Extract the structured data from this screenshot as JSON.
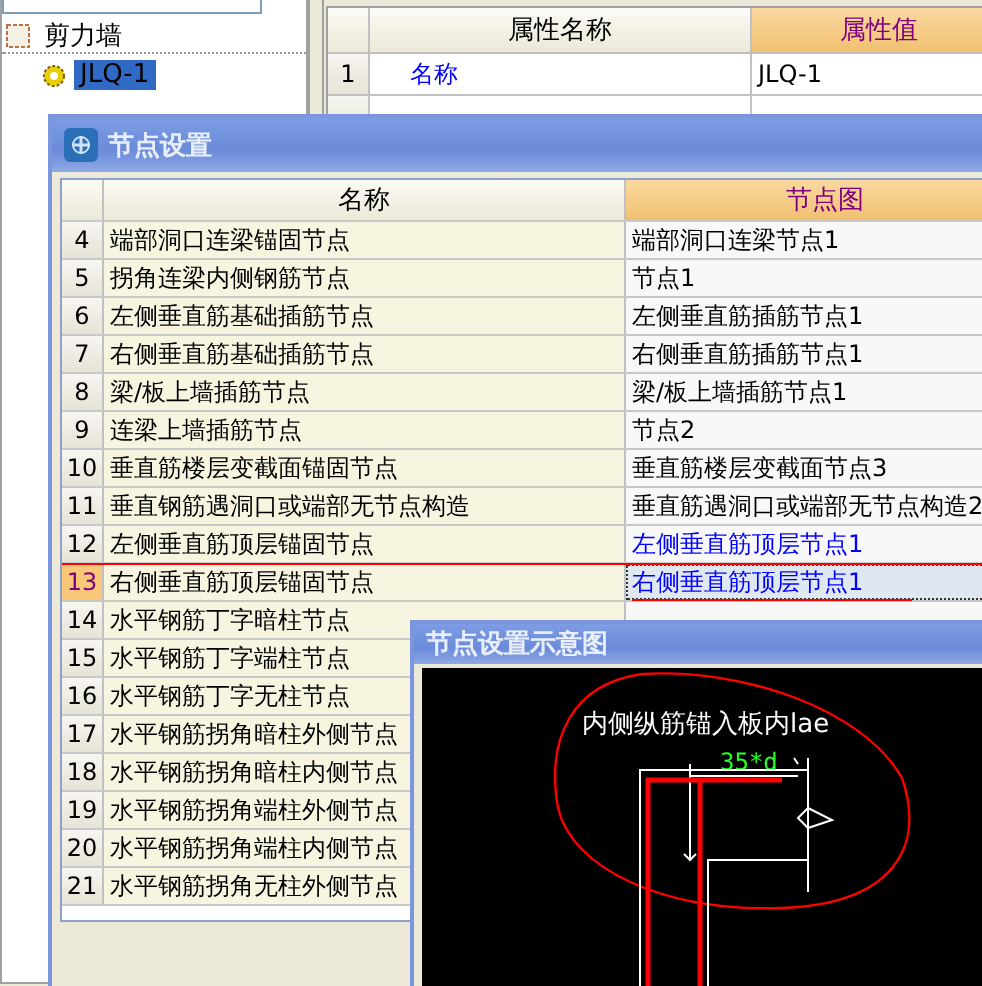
{
  "tree": {
    "items": [
      {
        "label": "剪力墙",
        "expanded": true,
        "children": [
          {
            "label": "JLQ-1",
            "selected": true
          }
        ]
      }
    ]
  },
  "properties": {
    "columns": [
      "属性名称",
      "属性值"
    ],
    "rows": [
      {
        "index": "1",
        "name": "名称",
        "value": "JLQ-1",
        "public": true
      }
    ]
  },
  "dialog": {
    "title": "节点设置",
    "columns": [
      "名称",
      "节点图"
    ],
    "rows": [
      {
        "index": "4",
        "name": "端部洞口连梁锚固节点",
        "node": "端部洞口连梁节点1",
        "selected": false,
        "modified": false
      },
      {
        "index": "5",
        "name": "拐角连梁内侧钢筋节点",
        "node": "节点1",
        "selected": false,
        "modified": false
      },
      {
        "index": "6",
        "name": "左侧垂直筋基础插筋节点",
        "node": "左侧垂直筋插筋节点1",
        "selected": false,
        "modified": false
      },
      {
        "index": "7",
        "name": "右侧垂直筋基础插筋节点",
        "node": "右侧垂直筋插筋节点1",
        "selected": false,
        "modified": false
      },
      {
        "index": "8",
        "name": "梁/板上墙插筋节点",
        "node": "梁/板上墙插筋节点1",
        "selected": false,
        "modified": false
      },
      {
        "index": "9",
        "name": "连梁上墙插筋节点",
        "node": "节点2",
        "selected": false,
        "modified": false
      },
      {
        "index": "10",
        "name": "垂直筋楼层变截面锚固节点",
        "node": "垂直筋楼层变截面节点3",
        "selected": false,
        "modified": false
      },
      {
        "index": "11",
        "name": "垂直钢筋遇洞口或端部无节点构造",
        "node": "垂直筋遇洞口或端部无节点构造2",
        "selected": false,
        "modified": false
      },
      {
        "index": "12",
        "name": "左侧垂直筋顶层锚固节点",
        "node": "左侧垂直筋顶层节点1",
        "selected": false,
        "modified": true
      },
      {
        "index": "13",
        "name": "右侧垂直筋顶层锚固节点",
        "node": "右侧垂直筋顶层节点1",
        "selected": true,
        "modified": true
      },
      {
        "index": "14",
        "name": "水平钢筋丁字暗柱节点",
        "selected": false
      },
      {
        "index": "15",
        "name": "水平钢筋丁字端柱节点",
        "selected": false
      },
      {
        "index": "16",
        "name": "水平钢筋丁字无柱节点",
        "selected": false
      },
      {
        "index": "17",
        "name": "水平钢筋拐角暗柱外侧节点",
        "selected": false
      },
      {
        "index": "18",
        "name": "水平钢筋拐角暗柱内侧节点",
        "selected": false
      },
      {
        "index": "19",
        "name": "水平钢筋拐角端柱外侧节点",
        "selected": false
      },
      {
        "index": "20",
        "name": "水平钢筋拐角端柱内侧节点",
        "selected": false
      },
      {
        "index": "21",
        "name": "水平钢筋拐角无柱外侧节点",
        "selected": false
      }
    ]
  },
  "preview": {
    "title": "节点设置示意图",
    "caption": "内侧纵筋锚入板内lae",
    "dimension": "35*d"
  }
}
